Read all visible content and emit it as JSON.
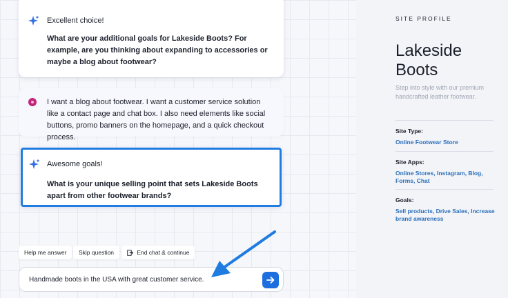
{
  "chat": {
    "messages": [
      {
        "sender": "assistant",
        "intro": "Excellent choice!",
        "question": "What are your additional goals for Lakeside Boots? For example, are you thinking about expanding to accessories or maybe a blog about footwear?"
      },
      {
        "sender": "user",
        "text": "I want a blog about footwear. I want a customer service solution like a contact page and chat box. I also need elements like social buttons, promo banners on the homepage, and a quick checkout process."
      },
      {
        "sender": "assistant",
        "intro": "Awesome goals!",
        "question": "What is your unique selling point that sets Lakeside Boots apart from other footwear brands?"
      }
    ],
    "quick_actions": {
      "help": "Help me answer",
      "skip": "Skip question",
      "end": "End chat & continue"
    },
    "input_value": "Handmade boots in the USA with great customer service."
  },
  "profile": {
    "heading": "SITE PROFILE",
    "site_name": "Lakeside Boots",
    "tagline": "Step into style with our premium handcrafted leather footwear.",
    "site_type_label": "Site Type:",
    "site_type_value": "Online Footwear Store",
    "site_apps_label": "Site Apps:",
    "site_apps_value": "Online Stores, Instagram, Blog, Forms, Chat",
    "goals_label": "Goals:",
    "goals_value": "Sell products, Drive Sales, Increase brand awareness"
  },
  "colors": {
    "accent": "#1f7ce0",
    "link": "#2b6fba",
    "sparkle": "#2f6fe8",
    "user_avatar": "#c2257a"
  },
  "icons": [
    "sparkle-icon",
    "user-avatar-icon",
    "exit-icon",
    "arrow-right-icon",
    "pointer-arrow-icon"
  ]
}
